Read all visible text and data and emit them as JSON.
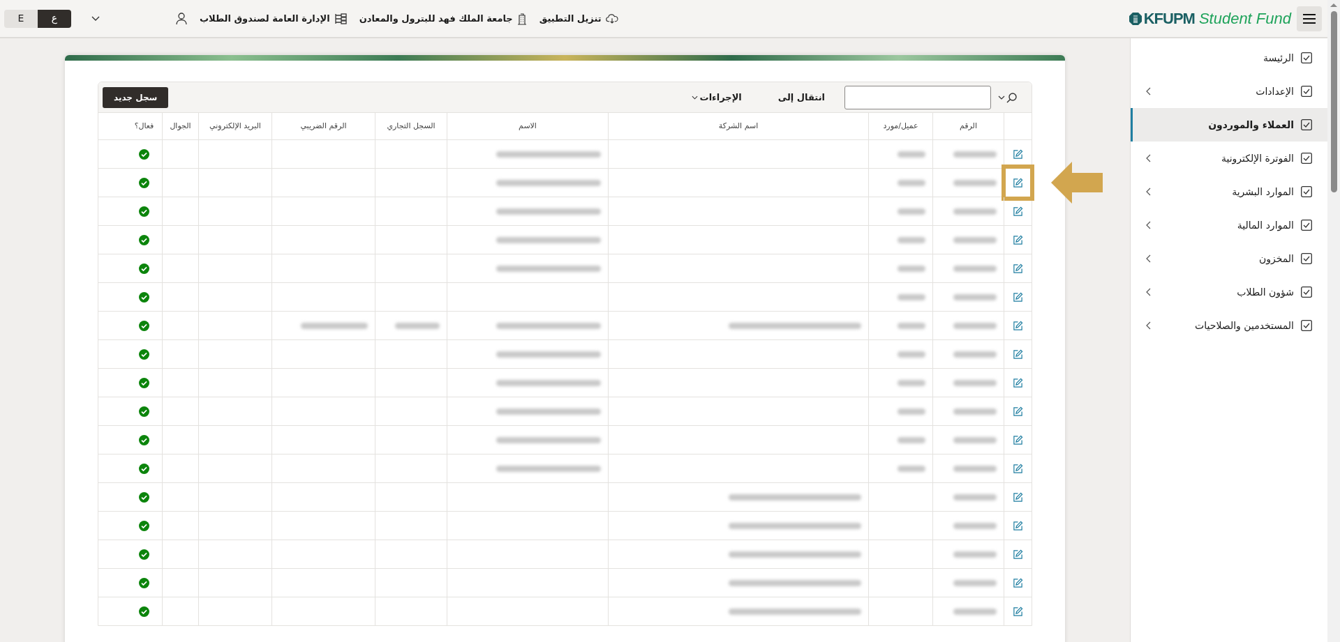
{
  "header": {
    "app_name_bold": "KFUPM",
    "app_name_light": "Student Fund",
    "links": [
      {
        "kind": "download",
        "label": "تنزيل التطبيق"
      },
      {
        "kind": "building",
        "label": "جامعة الملك فهد للبترول والمعادن"
      },
      {
        "kind": "org",
        "label": "الإدارة العامة لصندوق الطلاب"
      },
      {
        "kind": "user"
      }
    ],
    "languages": [
      {
        "label": "ع",
        "selected": true
      },
      {
        "label": "E",
        "selected": false
      }
    ]
  },
  "sidebar": {
    "items": [
      {
        "label": "الرئيسة",
        "selected": false,
        "has_children": false
      },
      {
        "label": "الإعدادات",
        "selected": false,
        "has_children": true
      },
      {
        "label": "العملاء والموردون",
        "selected": true,
        "has_children": false
      },
      {
        "label": "الفوترة الإلكترونية",
        "selected": false,
        "has_children": true
      },
      {
        "label": "الموارد البشرية",
        "selected": false,
        "has_children": true
      },
      {
        "label": "الموارد المالية",
        "selected": false,
        "has_children": true
      },
      {
        "label": "المخزون",
        "selected": false,
        "has_children": true
      },
      {
        "label": "شؤون الطلاب",
        "selected": false,
        "has_children": true
      },
      {
        "label": "المستخدمين والصلاحيات",
        "selected": false,
        "has_children": true
      }
    ]
  },
  "toolbar": {
    "goto_label": "انتقال إلى",
    "actions_label": "الإجراءات",
    "new_button": "سجل جديد"
  },
  "table": {
    "columns": [
      {},
      {
        "label": "الرقم"
      },
      {
        "label": "عميل/مورد"
      },
      {
        "label": "اسم الشركة"
      },
      {
        "label": "الاسم"
      },
      {
        "label": "السجل التجاري"
      },
      {
        "label": "الرقم الضريبي"
      },
      {
        "label": "البريد الإلكتروني"
      },
      {
        "label": "الجوال"
      },
      {
        "label": "فعال؟"
      }
    ],
    "rows": [
      {
        "highlighted": false,
        "active": true,
        "cells": [
          {
            "kind": "edit"
          },
          {
            "kind": "blurred"
          },
          {
            "kind": "blurred"
          },
          {
            "kind": "empty"
          },
          {
            "kind": "blurred"
          },
          {
            "kind": "empty"
          },
          {
            "kind": "empty"
          },
          {
            "kind": "empty"
          },
          {
            "kind": "empty"
          },
          {
            "kind": "check"
          }
        ]
      },
      {
        "highlighted": true,
        "active": true,
        "cells": [
          {
            "kind": "edit"
          },
          {
            "kind": "blurred"
          },
          {
            "kind": "blurred"
          },
          {
            "kind": "empty"
          },
          {
            "kind": "blurred"
          },
          {
            "kind": "empty"
          },
          {
            "kind": "empty"
          },
          {
            "kind": "empty"
          },
          {
            "kind": "empty"
          },
          {
            "kind": "check"
          }
        ]
      },
      {
        "highlighted": false,
        "active": true,
        "cells": [
          {
            "kind": "edit"
          },
          {
            "kind": "blurred"
          },
          {
            "kind": "blurred"
          },
          {
            "kind": "empty"
          },
          {
            "kind": "blurred"
          },
          {
            "kind": "empty"
          },
          {
            "kind": "empty"
          },
          {
            "kind": "empty"
          },
          {
            "kind": "empty"
          },
          {
            "kind": "check"
          }
        ]
      },
      {
        "highlighted": false,
        "active": true,
        "cells": [
          {
            "kind": "edit"
          },
          {
            "kind": "blurred"
          },
          {
            "kind": "blurred"
          },
          {
            "kind": "empty"
          },
          {
            "kind": "blurred"
          },
          {
            "kind": "empty"
          },
          {
            "kind": "empty"
          },
          {
            "kind": "empty"
          },
          {
            "kind": "empty"
          },
          {
            "kind": "check"
          }
        ]
      },
      {
        "highlighted": false,
        "active": true,
        "cells": [
          {
            "kind": "edit"
          },
          {
            "kind": "blurred"
          },
          {
            "kind": "blurred"
          },
          {
            "kind": "empty"
          },
          {
            "kind": "blurred"
          },
          {
            "kind": "empty"
          },
          {
            "kind": "empty"
          },
          {
            "kind": "empty"
          },
          {
            "kind": "empty"
          },
          {
            "kind": "check"
          }
        ]
      },
      {
        "highlighted": false,
        "active": true,
        "cells": [
          {
            "kind": "edit"
          },
          {
            "kind": "blurred"
          },
          {
            "kind": "blurred"
          },
          {
            "kind": "empty"
          },
          {
            "kind": "empty"
          },
          {
            "kind": "empty"
          },
          {
            "kind": "empty"
          },
          {
            "kind": "empty"
          },
          {
            "kind": "empty"
          },
          {
            "kind": "check"
          }
        ]
      },
      {
        "highlighted": false,
        "active": true,
        "cells": [
          {
            "kind": "edit"
          },
          {
            "kind": "blurred"
          },
          {
            "kind": "blurred"
          },
          {
            "kind": "blurred"
          },
          {
            "kind": "blurred"
          },
          {
            "kind": "blurred"
          },
          {
            "kind": "blurred"
          },
          {
            "kind": "empty"
          },
          {
            "kind": "empty"
          },
          {
            "kind": "check"
          }
        ]
      },
      {
        "highlighted": false,
        "active": true,
        "cells": [
          {
            "kind": "edit"
          },
          {
            "kind": "blurred"
          },
          {
            "kind": "blurred"
          },
          {
            "kind": "empty"
          },
          {
            "kind": "blurred"
          },
          {
            "kind": "empty"
          },
          {
            "kind": "empty"
          },
          {
            "kind": "empty"
          },
          {
            "kind": "empty"
          },
          {
            "kind": "check"
          }
        ]
      },
      {
        "highlighted": false,
        "active": true,
        "cells": [
          {
            "kind": "edit"
          },
          {
            "kind": "blurred"
          },
          {
            "kind": "blurred"
          },
          {
            "kind": "empty"
          },
          {
            "kind": "blurred"
          },
          {
            "kind": "empty"
          },
          {
            "kind": "empty"
          },
          {
            "kind": "empty"
          },
          {
            "kind": "empty"
          },
          {
            "kind": "check"
          }
        ]
      },
      {
        "highlighted": false,
        "active": true,
        "cells": [
          {
            "kind": "edit"
          },
          {
            "kind": "blurred"
          },
          {
            "kind": "blurred"
          },
          {
            "kind": "empty"
          },
          {
            "kind": "blurred"
          },
          {
            "kind": "empty"
          },
          {
            "kind": "empty"
          },
          {
            "kind": "empty"
          },
          {
            "kind": "empty"
          },
          {
            "kind": "check"
          }
        ]
      },
      {
        "highlighted": false,
        "active": true,
        "cells": [
          {
            "kind": "edit"
          },
          {
            "kind": "blurred"
          },
          {
            "kind": "blurred"
          },
          {
            "kind": "empty"
          },
          {
            "kind": "blurred"
          },
          {
            "kind": "empty"
          },
          {
            "kind": "empty"
          },
          {
            "kind": "empty"
          },
          {
            "kind": "empty"
          },
          {
            "kind": "check"
          }
        ]
      },
      {
        "highlighted": false,
        "active": true,
        "cells": [
          {
            "kind": "edit"
          },
          {
            "kind": "blurred"
          },
          {
            "kind": "blurred"
          },
          {
            "kind": "empty"
          },
          {
            "kind": "blurred"
          },
          {
            "kind": "empty"
          },
          {
            "kind": "empty"
          },
          {
            "kind": "empty"
          },
          {
            "kind": "empty"
          },
          {
            "kind": "check"
          }
        ]
      },
      {
        "highlighted": false,
        "active": true,
        "cells": [
          {
            "kind": "edit"
          },
          {
            "kind": "blurred"
          },
          {
            "kind": "empty"
          },
          {
            "kind": "blurred"
          },
          {
            "kind": "empty"
          },
          {
            "kind": "empty"
          },
          {
            "kind": "empty"
          },
          {
            "kind": "empty"
          },
          {
            "kind": "empty"
          },
          {
            "kind": "check"
          }
        ]
      },
      {
        "highlighted": false,
        "active": true,
        "cells": [
          {
            "kind": "edit"
          },
          {
            "kind": "blurred"
          },
          {
            "kind": "empty"
          },
          {
            "kind": "blurred"
          },
          {
            "kind": "empty"
          },
          {
            "kind": "empty"
          },
          {
            "kind": "empty"
          },
          {
            "kind": "empty"
          },
          {
            "kind": "empty"
          },
          {
            "kind": "check"
          }
        ]
      },
      {
        "highlighted": false,
        "active": true,
        "cells": [
          {
            "kind": "edit"
          },
          {
            "kind": "blurred"
          },
          {
            "kind": "empty"
          },
          {
            "kind": "blurred"
          },
          {
            "kind": "empty"
          },
          {
            "kind": "empty"
          },
          {
            "kind": "empty"
          },
          {
            "kind": "empty"
          },
          {
            "kind": "empty"
          },
          {
            "kind": "check"
          }
        ]
      },
      {
        "highlighted": false,
        "active": true,
        "cells": [
          {
            "kind": "edit"
          },
          {
            "kind": "blurred"
          },
          {
            "kind": "empty"
          },
          {
            "kind": "blurred"
          },
          {
            "kind": "empty"
          },
          {
            "kind": "empty"
          },
          {
            "kind": "empty"
          },
          {
            "kind": "empty"
          },
          {
            "kind": "empty"
          },
          {
            "kind": "check"
          }
        ]
      },
      {
        "highlighted": false,
        "active": true,
        "cells": [
          {
            "kind": "edit"
          },
          {
            "kind": "blurred"
          },
          {
            "kind": "empty"
          },
          {
            "kind": "blurred"
          },
          {
            "kind": "empty"
          },
          {
            "kind": "empty"
          },
          {
            "kind": "empty"
          },
          {
            "kind": "empty"
          },
          {
            "kind": "empty"
          },
          {
            "kind": "check"
          }
        ]
      }
    ]
  }
}
